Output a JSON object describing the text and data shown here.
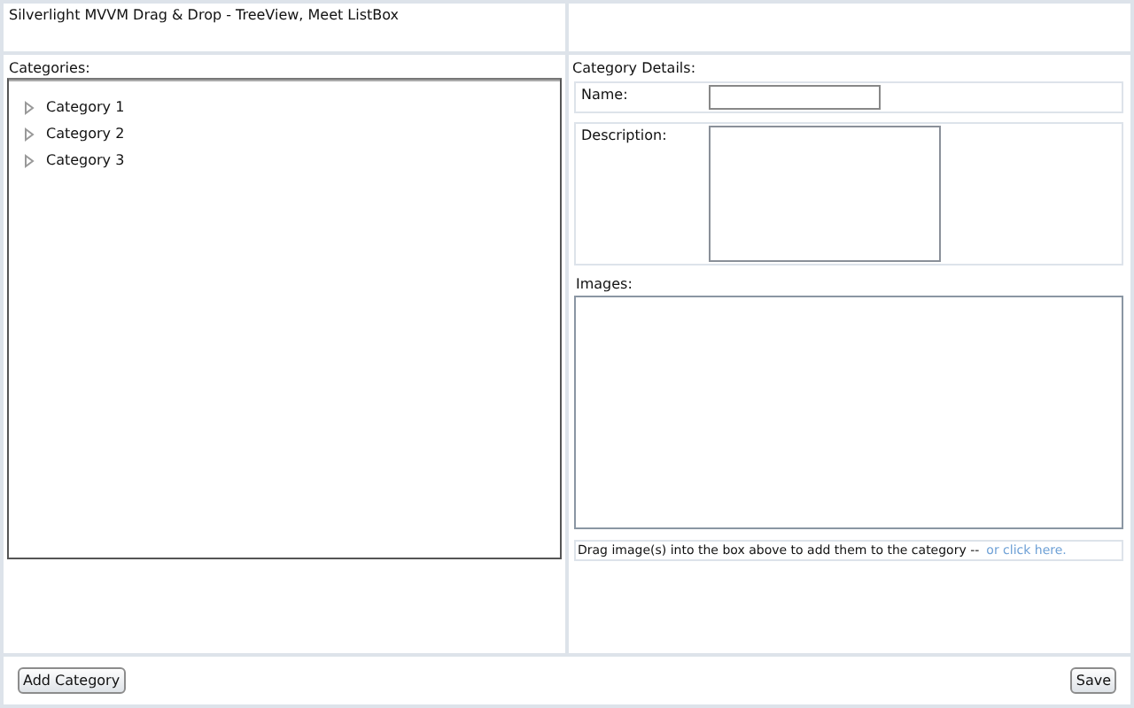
{
  "window": {
    "title": "Silverlight MVVM Drag & Drop - TreeView, Meet ListBox"
  },
  "categories": {
    "label": "Categories:",
    "items": [
      {
        "label": "Category 1",
        "expanded": false
      },
      {
        "label": "Category 2",
        "expanded": false
      },
      {
        "label": "Category 3",
        "expanded": false
      }
    ]
  },
  "details": {
    "label": "Category Details:",
    "name_label": "Name:",
    "description_label": "Description:",
    "images_label": "Images:",
    "drag_hint": "Drag image(s) into the box above to add them to the category --",
    "click_link": "or click here."
  },
  "buttons": {
    "add": "Add Category",
    "save": "Save"
  }
}
